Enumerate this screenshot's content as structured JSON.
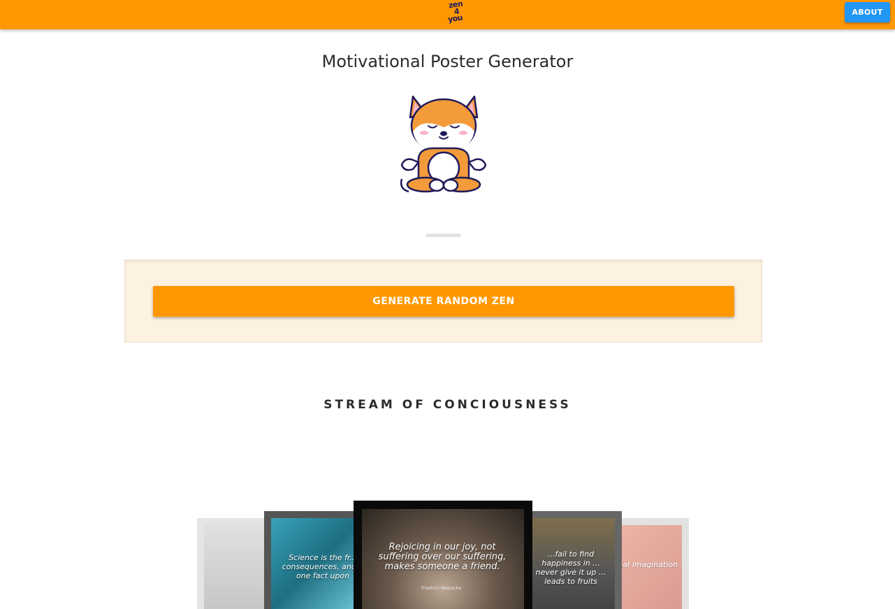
{
  "header": {
    "logo_lines": [
      "zen",
      "4",
      "you"
    ],
    "about_label": "ABOUT"
  },
  "main": {
    "title": "Motivational Poster Generator",
    "generate_label": "GENERATE RANDOM ZEN"
  },
  "stream": {
    "title": "STREAM OF CONCIOUSNESS",
    "posters": [
      {
        "quote": "Science is the fr... consequences, and... one fact upon"
      },
      {
        "quote": "Rejoicing in our joy, not suffering over our suffering, makes someone a friend.",
        "author": "Friedrich Nietzsche"
      },
      {
        "quote": "...fail to find happiness in ... never give it up ... leads to fruits"
      },
      {
        "quote": "...ual imagination"
      }
    ]
  },
  "colors": {
    "brand_orange": "#ff9800",
    "about_blue": "#2196f3",
    "panel_bg": "#fdf1e0"
  }
}
